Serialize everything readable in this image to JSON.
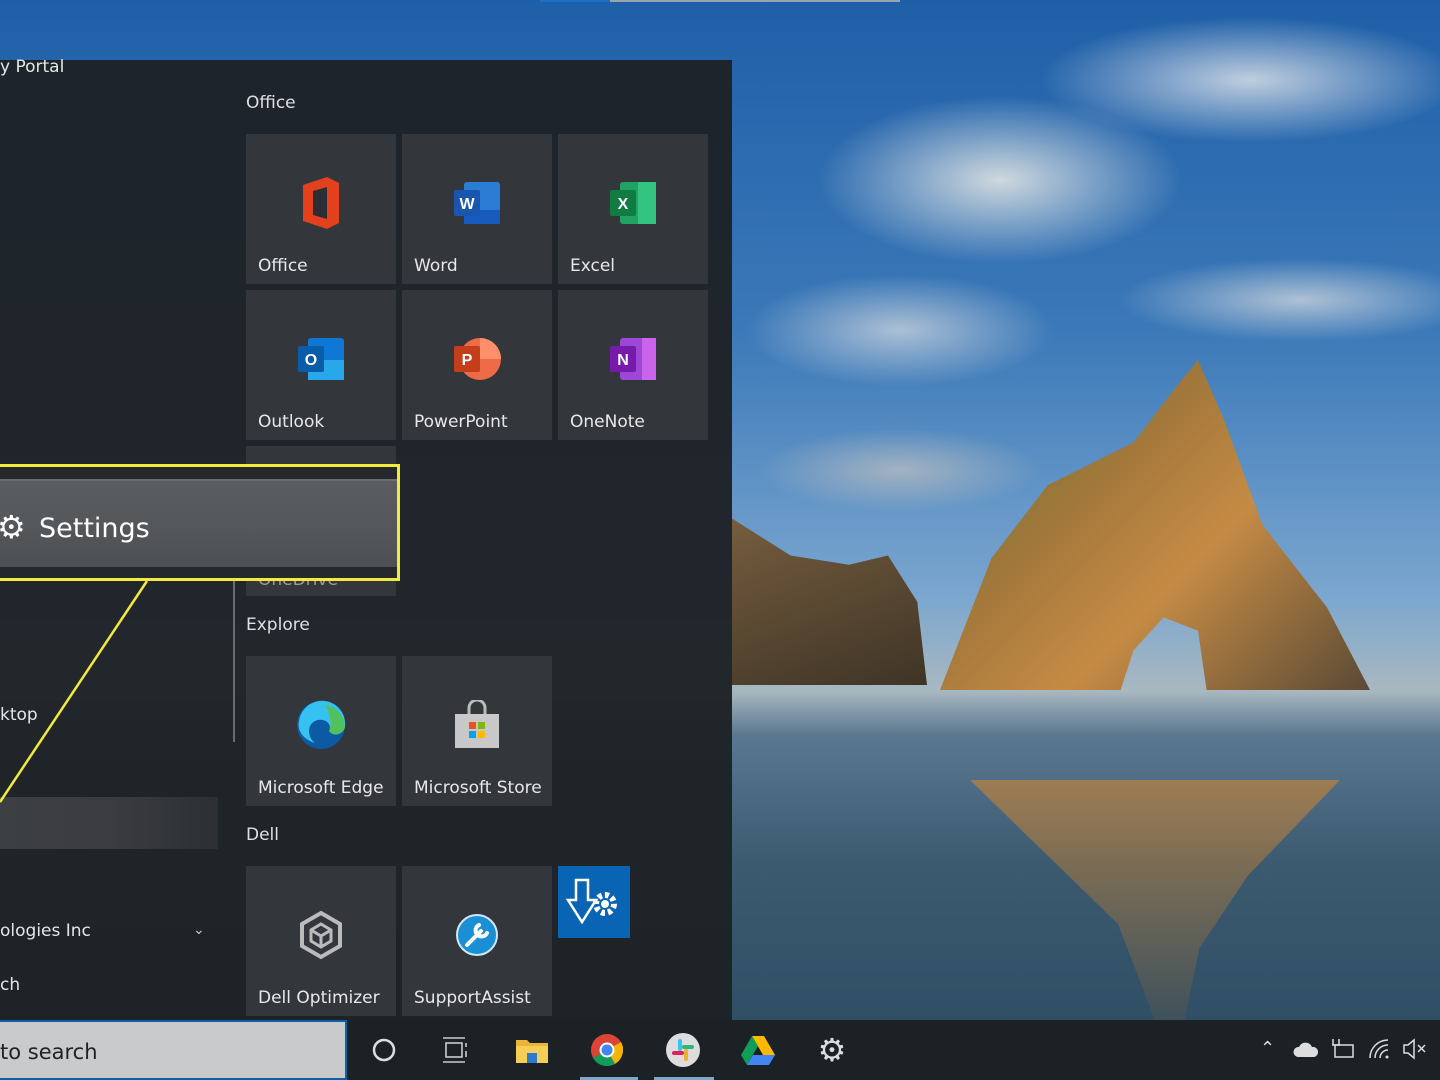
{
  "start_menu": {
    "left_list": {
      "items": [
        {
          "label": "y Portal"
        },
        {
          "label": "ktop"
        },
        {
          "label": "ologies Inc",
          "expandable": true
        },
        {
          "label": "ch"
        }
      ]
    },
    "groups": [
      {
        "title": "Office",
        "tiles": [
          {
            "label": "Office",
            "icon": "office-icon"
          },
          {
            "label": "Word",
            "icon": "word-icon"
          },
          {
            "label": "Excel",
            "icon": "excel-icon"
          },
          {
            "label": "Outlook",
            "icon": "outlook-icon"
          },
          {
            "label": "PowerPoint",
            "icon": "powerpoint-icon"
          },
          {
            "label": "OneNote",
            "icon": "onenote-icon"
          },
          {
            "label": "OneDrive",
            "icon": "onedrive-icon"
          }
        ]
      },
      {
        "title": "Explore",
        "tiles": [
          {
            "label": "Microsoft Edge",
            "icon": "edge-icon"
          },
          {
            "label": "Microsoft Store",
            "icon": "store-icon"
          }
        ]
      },
      {
        "title": "Dell",
        "tiles": [
          {
            "label": "Dell Optimizer",
            "icon": "dell-optimizer-icon"
          },
          {
            "label": "SupportAssist",
            "icon": "supportassist-icon"
          },
          {
            "label": "",
            "icon": "dell-update-icon"
          }
        ]
      }
    ]
  },
  "callout": {
    "label": "Settings",
    "icon": "gear-icon",
    "color": "#f2ea3d"
  },
  "taskbar": {
    "search_text": "to search",
    "apps": [
      {
        "name": "cortana"
      },
      {
        "name": "task-view"
      },
      {
        "name": "file-explorer"
      },
      {
        "name": "chrome",
        "active": true
      },
      {
        "name": "slack",
        "active": true
      },
      {
        "name": "google-drive"
      },
      {
        "name": "settings"
      }
    ],
    "tray": [
      "show-hidden-icons",
      "onedrive",
      "battery",
      "wifi",
      "volume-muted"
    ]
  }
}
